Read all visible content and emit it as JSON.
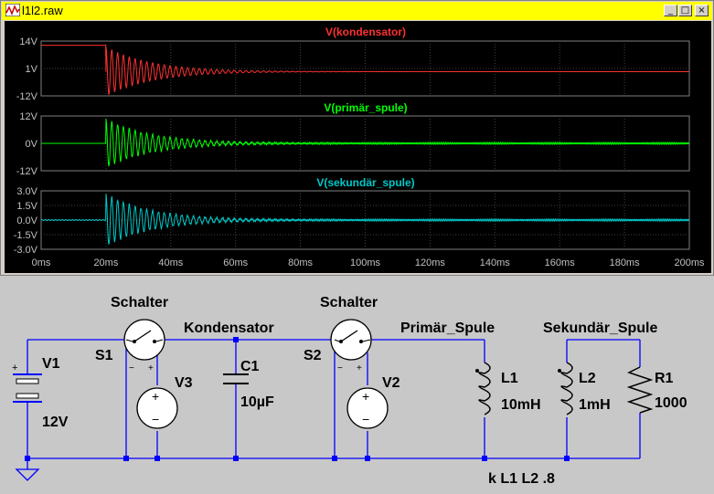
{
  "window": {
    "title": "l1l2.raw",
    "minimize_glyph": "_",
    "restore_glyph": "□",
    "close_glyph": "×"
  },
  "chart_data": [
    {
      "type": "line",
      "title": "V(kondensator)",
      "ylabel_ticks": [
        "14V",
        "1V",
        "-12V"
      ],
      "ylim": [
        -12,
        14
      ],
      "xlim": [
        0,
        200
      ],
      "x_unit": "ms",
      "series": [
        {
          "name": "V(kondensator)",
          "color": "#ff3030",
          "dc_before_ms": 20,
          "level_before_V": 12,
          "decay_start_ms": 20,
          "baseline_V": 0
        }
      ]
    },
    {
      "type": "line",
      "title": "V(primär_spule)",
      "ylabel_ticks": [
        "12V",
        "0V",
        "-12V"
      ],
      "ylim": [
        -12,
        12
      ],
      "xlim": [
        0,
        200
      ],
      "x_unit": "ms",
      "series": [
        {
          "name": "V(primär_spule)",
          "color": "#00ff00",
          "decay_start_ms": 20,
          "baseline_V": 0
        }
      ]
    },
    {
      "type": "line",
      "title": "V(sekundär_spule)",
      "ylabel_ticks": [
        "3.0V",
        "1.5V",
        "0.0V",
        "-1.5V",
        "-3.0V"
      ],
      "ylim": [
        -3,
        3
      ],
      "xlim": [
        0,
        200
      ],
      "x_unit": "ms",
      "series": [
        {
          "name": "V(sekundär_spule)",
          "color": "#00c8c8",
          "decay_start_ms": 20,
          "baseline_V": 0
        }
      ]
    }
  ],
  "xticks": [
    "0ms",
    "20ms",
    "40ms",
    "60ms",
    "80ms",
    "100ms",
    "120ms",
    "140ms",
    "160ms",
    "180ms",
    "200ms"
  ],
  "schematic": {
    "v1_name": "V1",
    "v1_value": "12V",
    "s1_name": "S1",
    "s1_model": "Schalter",
    "v3_name": "V3",
    "node_kondensator": "Kondensator",
    "c1_name": "C1",
    "c1_value": "10µF",
    "s2_name": "S2",
    "s2_model": "Schalter",
    "v2_name": "V2",
    "node_primaer": "Primär_Spule",
    "l1_name": "L1",
    "l1_value": "10mH",
    "node_sekundaer": "Sekundär_Spule",
    "l2_name": "L2",
    "l2_value": "1mH",
    "r1_name": "R1",
    "r1_value": "1000",
    "coupling": "k L1 L2 .8",
    "plus": "+",
    "minus": "−"
  }
}
